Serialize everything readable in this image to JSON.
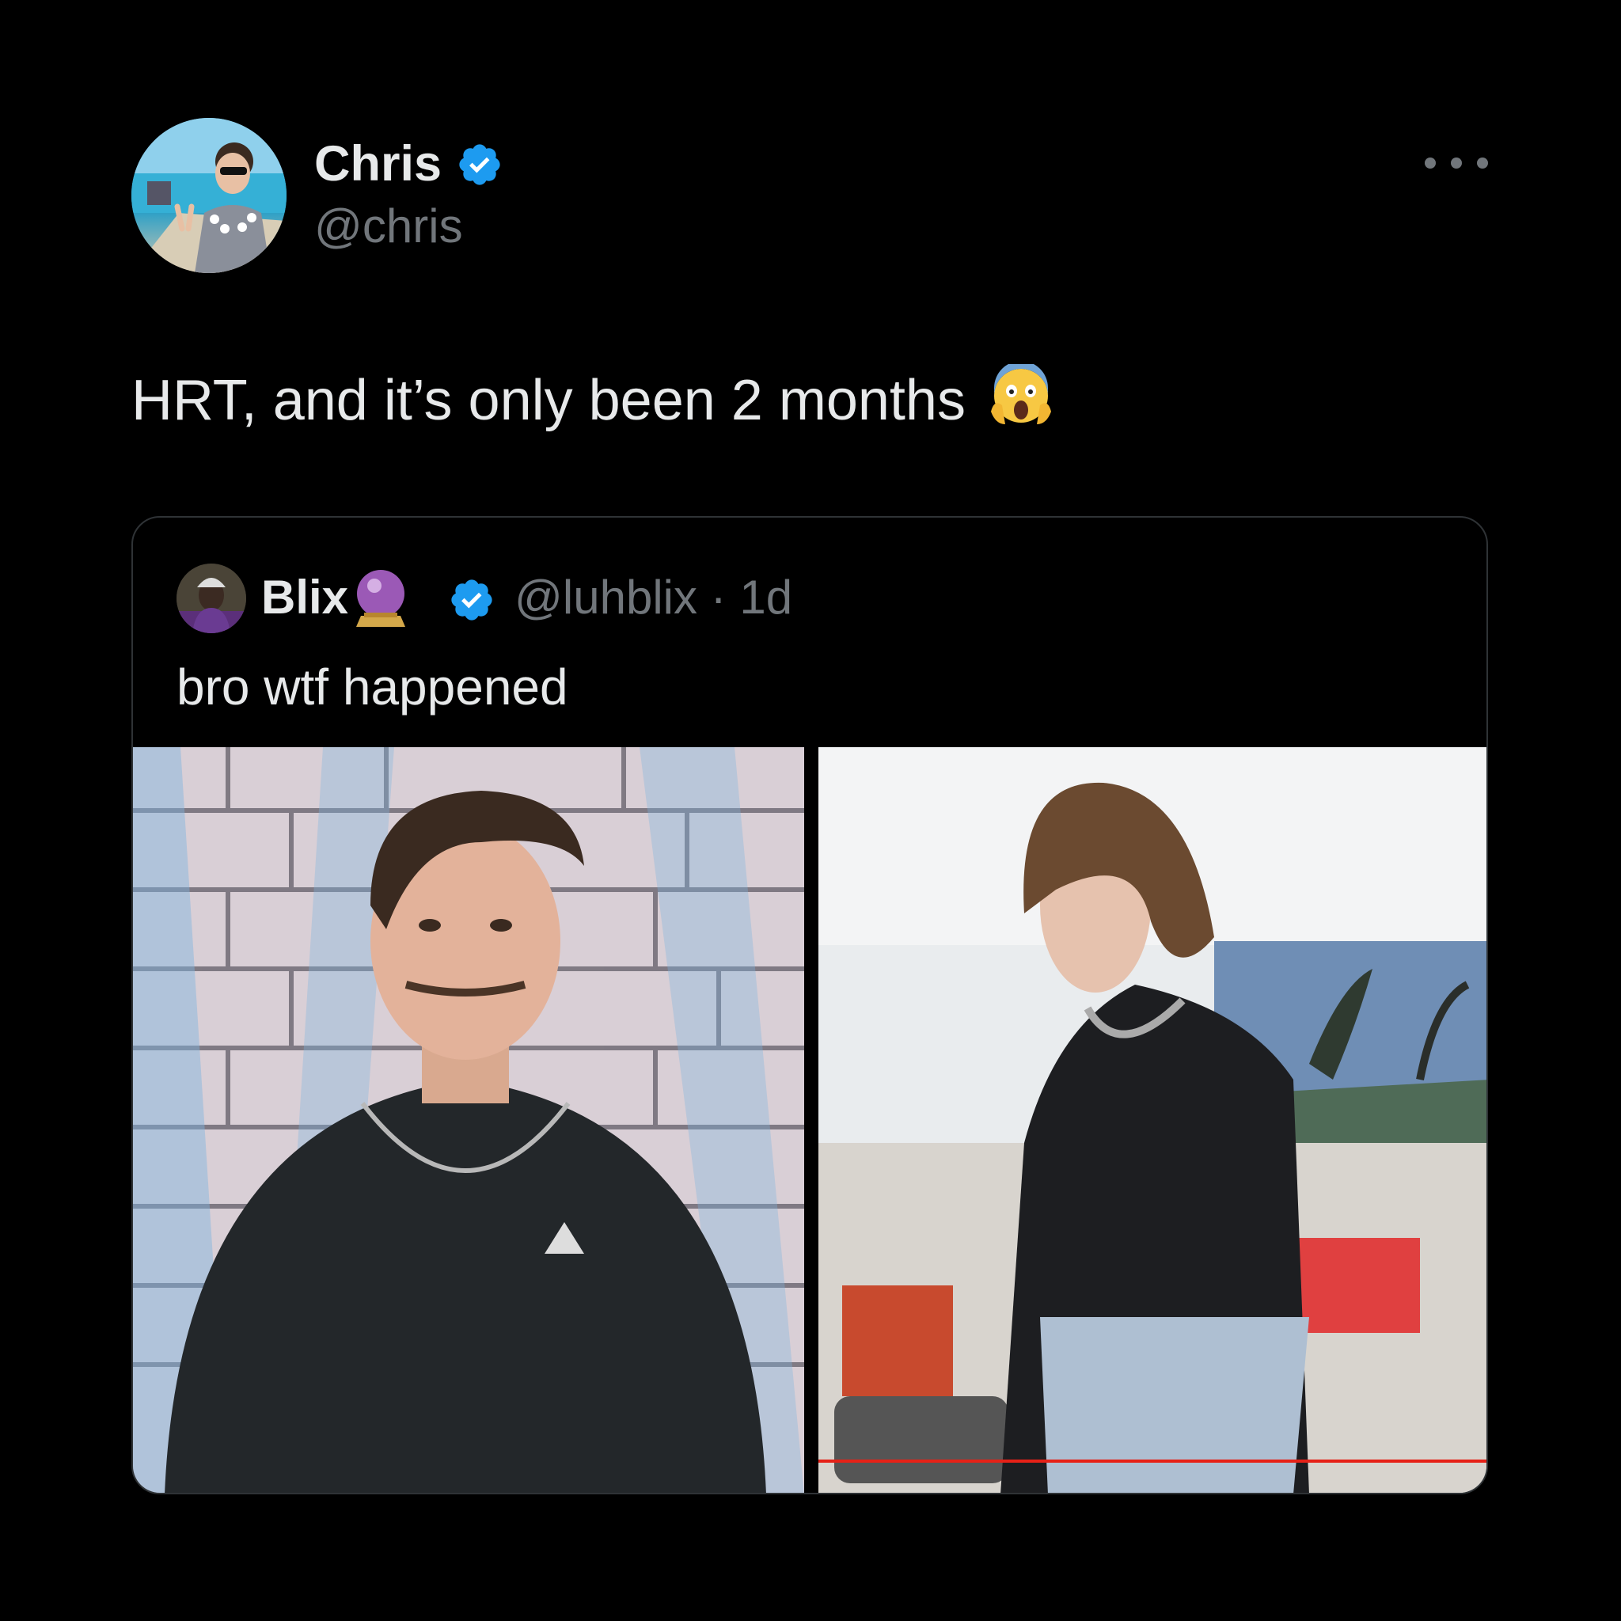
{
  "post": {
    "author_name": "Chris",
    "author_handle": "@chris",
    "text": "HRT, and it’s only been 2 months",
    "emoji": "face-screaming-in-fear",
    "verified": true
  },
  "quote": {
    "author_name": "Blix",
    "name_emoji": "crystal-ball",
    "author_handle": "@luhblix · 1d",
    "text": "bro wtf happened",
    "verified": true,
    "media": [
      {
        "name": "photo-left",
        "kind": "photo"
      },
      {
        "name": "photo-right",
        "kind": "video-frame",
        "progress": 1.0
      }
    ]
  },
  "colors": {
    "background": "#000000",
    "text_primary": "#e7e9ea",
    "text_secondary": "#71767b",
    "verified_blue": "#1d9bf0",
    "card_border": "#2f3336",
    "video_progress": "#e62117"
  }
}
